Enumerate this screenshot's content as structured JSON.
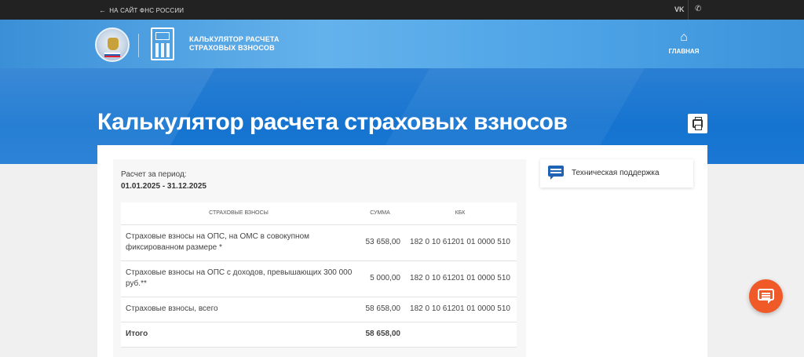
{
  "topbar": {
    "back_label": "НА САЙТ ФНС РОССИИ",
    "vk_label": "VK"
  },
  "header": {
    "title_line1": "КАЛЬКУЛЯТОР РАСЧЕТА",
    "title_line2": "СТРАХОВЫХ ВЗНОСОВ",
    "home_label": "ГЛАВНАЯ"
  },
  "hero": {
    "title": "Калькулятор расчета страховых взносов"
  },
  "result": {
    "period_label": "Расчет за период:",
    "period_value": "01.01.2025 - 31.12.2025",
    "columns": [
      "СТРАХОВЫЕ ВЗНОСЫ",
      "СУММА",
      "КБК"
    ],
    "rows": [
      {
        "name": "Страховые взносы на ОПС, на ОМС в совокупном фиксированном размере *",
        "sum": "53 658,00",
        "kbk": "182 0 10 61201 01 0000 510"
      },
      {
        "name": "Страховые взносы на ОПС с доходов, превышающих 300 000 руб.**",
        "sum": "5 000,00",
        "kbk": "182 0 10 61201 01 0000 510"
      },
      {
        "name": "Страховые взносы, всего",
        "sum": "58 658,00",
        "kbk": "182 0 10 61201 01 0000 510"
      },
      {
        "name": "Итого",
        "sum": "58 658,00",
        "kbk": ""
      }
    ]
  },
  "sidebar": {
    "support_label": "Техническая поддержка"
  },
  "icons": {
    "back": "arrow-left-icon",
    "phone": "phone-icon",
    "home": "home-icon",
    "print": "printer-icon",
    "support": "chat-icon",
    "fab": "chat-bubble-icon"
  },
  "colors": {
    "topbar": "#222222",
    "header": "#4ea4e6",
    "hero": "#1574d0",
    "fab": "#f05a28",
    "support_icon": "#1e63b6"
  }
}
